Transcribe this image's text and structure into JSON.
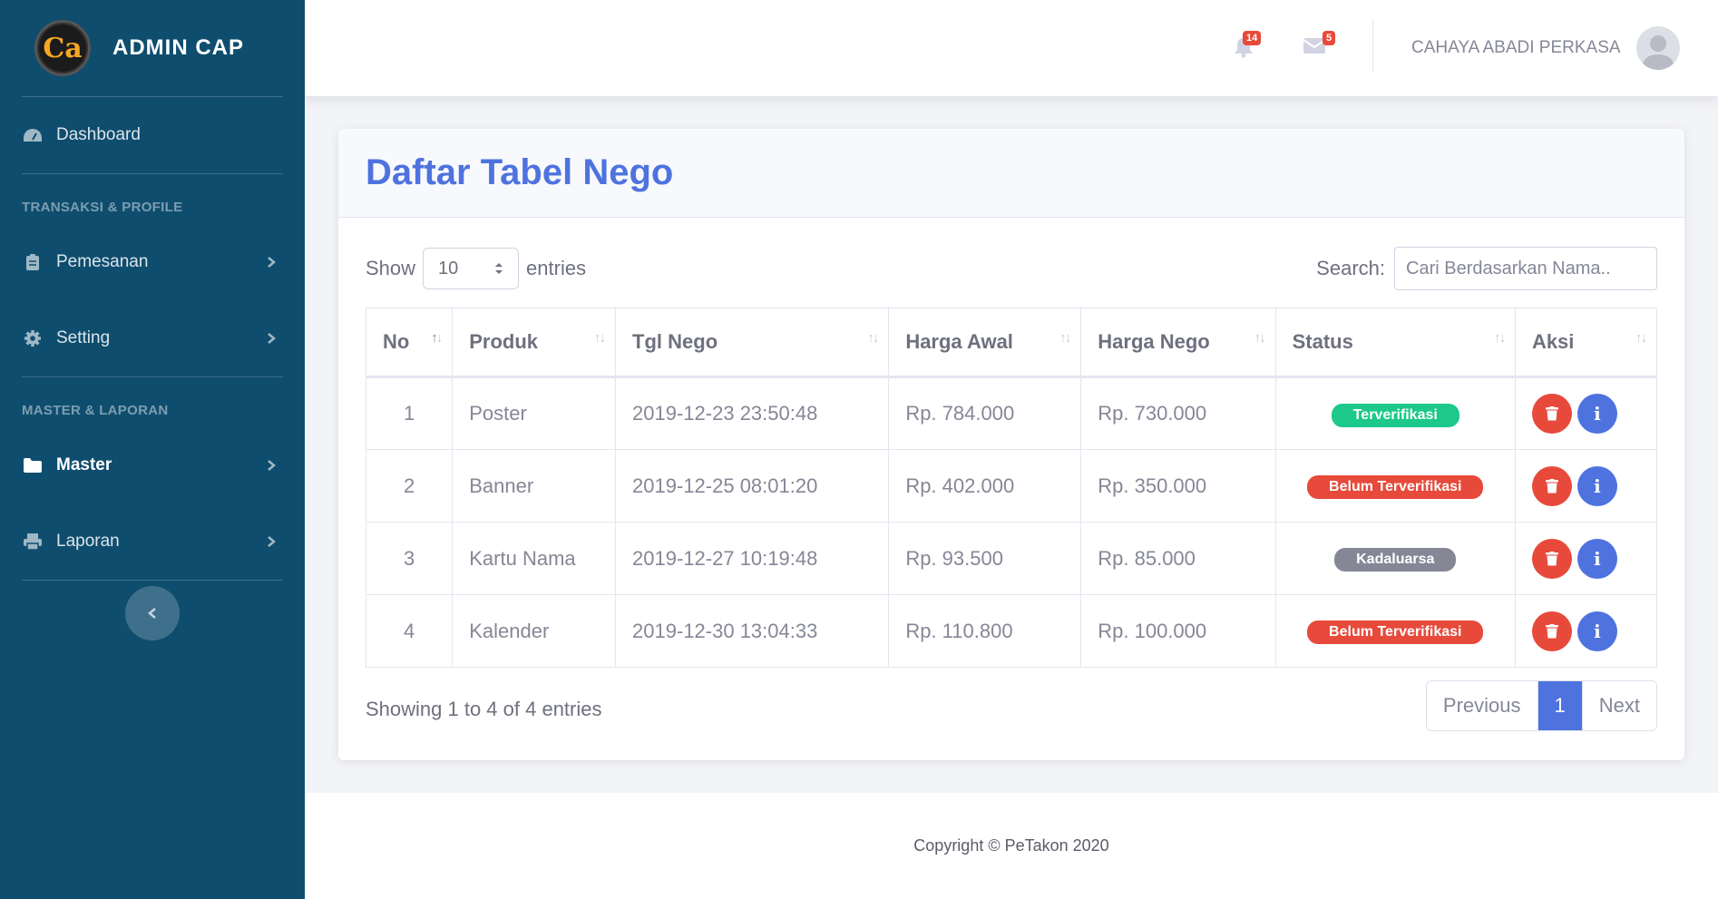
{
  "brand": {
    "logo_text": "Ca",
    "name": "ADMIN CAP"
  },
  "sidebar": {
    "dashboard": "Dashboard",
    "section1": "TRANSAKSI & PROFILE",
    "pemesanan": "Pemesanan",
    "setting": "Setting",
    "section2": "MASTER & LAPORAN",
    "master": "Master",
    "laporan": "Laporan"
  },
  "topbar": {
    "alerts_count": "14",
    "messages_count": "5",
    "user_name": "CAHAYA ABADI PERKASA"
  },
  "card": {
    "title": "Daftar Tabel Nego"
  },
  "controls": {
    "show_label": "Show",
    "entries_value": "10",
    "entries_label": "entries",
    "search_label": "Search:",
    "search_placeholder": "Cari Berdasarkan Nama.."
  },
  "table": {
    "headers": [
      "No",
      "Produk",
      "Tgl Nego",
      "Harga Awal",
      "Harga Nego",
      "Status",
      "Aksi"
    ],
    "rows": [
      {
        "no": "1",
        "produk": "Poster",
        "tgl": "2019-12-23 23:50:48",
        "awal": "Rp. 784.000",
        "nego": "Rp. 730.000",
        "status": "Terverifikasi",
        "status_color": "#1cc88a"
      },
      {
        "no": "2",
        "produk": "Banner",
        "tgl": "2019-12-25 08:01:20",
        "awal": "Rp. 402.000",
        "nego": "Rp. 350.000",
        "status": "Belum Terverifikasi",
        "status_color": "#e74a3b"
      },
      {
        "no": "3",
        "produk": "Kartu Nama",
        "tgl": "2019-12-27 10:19:48",
        "awal": "Rp. 93.500",
        "nego": "Rp. 85.000",
        "status": "Kadaluarsa",
        "status_color": "#858796"
      },
      {
        "no": "4",
        "produk": "Kalender",
        "tgl": "2019-12-30 13:04:33",
        "awal": "Rp. 110.800",
        "nego": "Rp. 100.000",
        "status": "Belum Terverifikasi",
        "status_color": "#e74a3b"
      }
    ]
  },
  "pagination": {
    "info": "Showing 1 to 4 of 4 entries",
    "previous": "Previous",
    "current": "1",
    "next": "Next"
  },
  "footer": {
    "copyright": "Copyright © PeTakon 2020"
  },
  "colors": {
    "sidebar": "#0f4d6e",
    "primary": "#4e73df",
    "success": "#1cc88a",
    "danger": "#e74a3b",
    "secondary": "#858796"
  }
}
